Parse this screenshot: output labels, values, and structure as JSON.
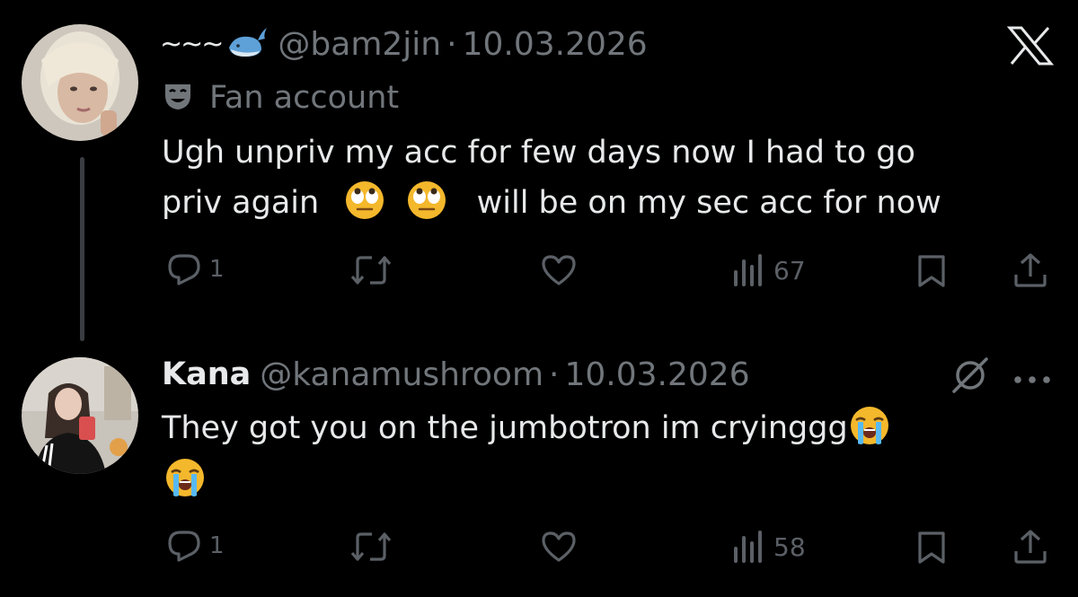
{
  "tweets": [
    {
      "display_name": "~~~",
      "handle": "@bam2jin",
      "separator": "·",
      "date": "10.03.2026",
      "label": "Fan account",
      "text_line1": "Ugh unpriv my acc for few days now I had to go",
      "text_line2_a": "priv again",
      "text_line2_b": "will be on my sec acc for now",
      "emoji": "eye-roll-emoji",
      "reply_count": "1",
      "views": "67"
    },
    {
      "display_name": "Kana",
      "handle": "@kanamushroom",
      "separator": "·",
      "date": "10.03.2026",
      "text_line1": "They got you on the jumbotron im cryinggg",
      "emoji": "loudly-crying-emoji",
      "reply_count": "1",
      "views": "58"
    }
  ],
  "icons": {
    "top_right": "x-logo-icon",
    "reply": "reply-icon",
    "retweet": "retweet-icon",
    "like": "like-icon",
    "views": "views-icon",
    "bookmark": "bookmark-icon",
    "share": "share-icon",
    "more": "more-icon",
    "grok": "grok-icon",
    "label_badge": "fan-account-mask-icon",
    "whale": "whale-emoji"
  },
  "colors": {
    "background": "#000000",
    "text": "#e7e9ea",
    "muted": "#71767b",
    "action_icons": "#5b6066",
    "thread_line": "#3a3d41",
    "emoji": "#f4b82c"
  }
}
